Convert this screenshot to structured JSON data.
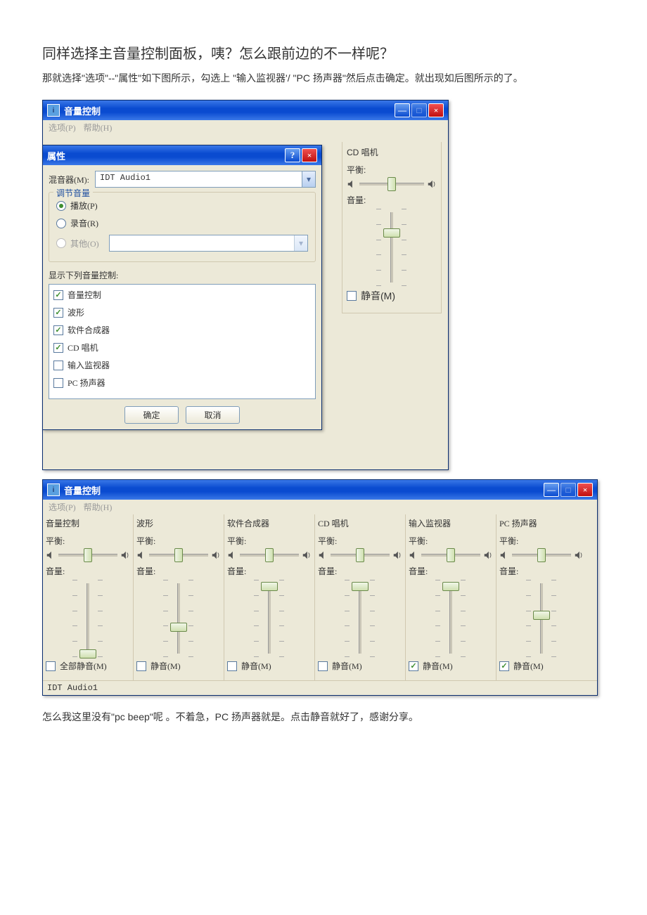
{
  "heading": "同样选择主音量控制面板，咦？怎么跟前边的不一样呢？",
  "para1": "那就选择\"选项\"--\"属性\"如下图所示，勾选上 \"输入监视器'/ \"PC 扬声器\"然后点击确定。就出现如后图所示的了。",
  "para2": "怎么我这里没有\"pc beep\"呢 。不着急，PC 扬声器就是。点击静音就好了，感谢分享。",
  "vc_title": "音量控制",
  "menu_opts": "选项(P)",
  "menu_help": "帮助(H)",
  "prop_title": "属性",
  "mixer_lbl": "混音器(M):",
  "mixer_val": "IDT Audio1",
  "adjust_group": "调节音量",
  "r_play": "播放(P)",
  "r_rec": "录音(R)",
  "r_other": "其他(O)",
  "showlist_lbl": "显示下列音量控制:",
  "chk": {
    "vc": "音量控制",
    "wave": "波形",
    "synth": "软件合成器",
    "cd": "CD 唱机",
    "inmon": "输入监视器",
    "pcspk": "PC 扬声器"
  },
  "btn_ok": "确定",
  "btn_cancel": "取消",
  "balance": "平衡:",
  "volume": "音量:",
  "mute": "静音(M)",
  "mute_all": "全部静音(M)",
  "status": "IDT Audio1",
  "ch": {
    "vc": "音量控制",
    "wave": "波形",
    "synth": "软件合成器",
    "cd": "CD 唱机",
    "inmon": "输入监视器",
    "pcspk": "PC 扬声器"
  },
  "thumb_pos": {
    "vc": 90,
    "wave": 55,
    "synth": 3,
    "cd": 3,
    "inmon": 3,
    "pcspk": 40,
    "cd_small": 25
  }
}
